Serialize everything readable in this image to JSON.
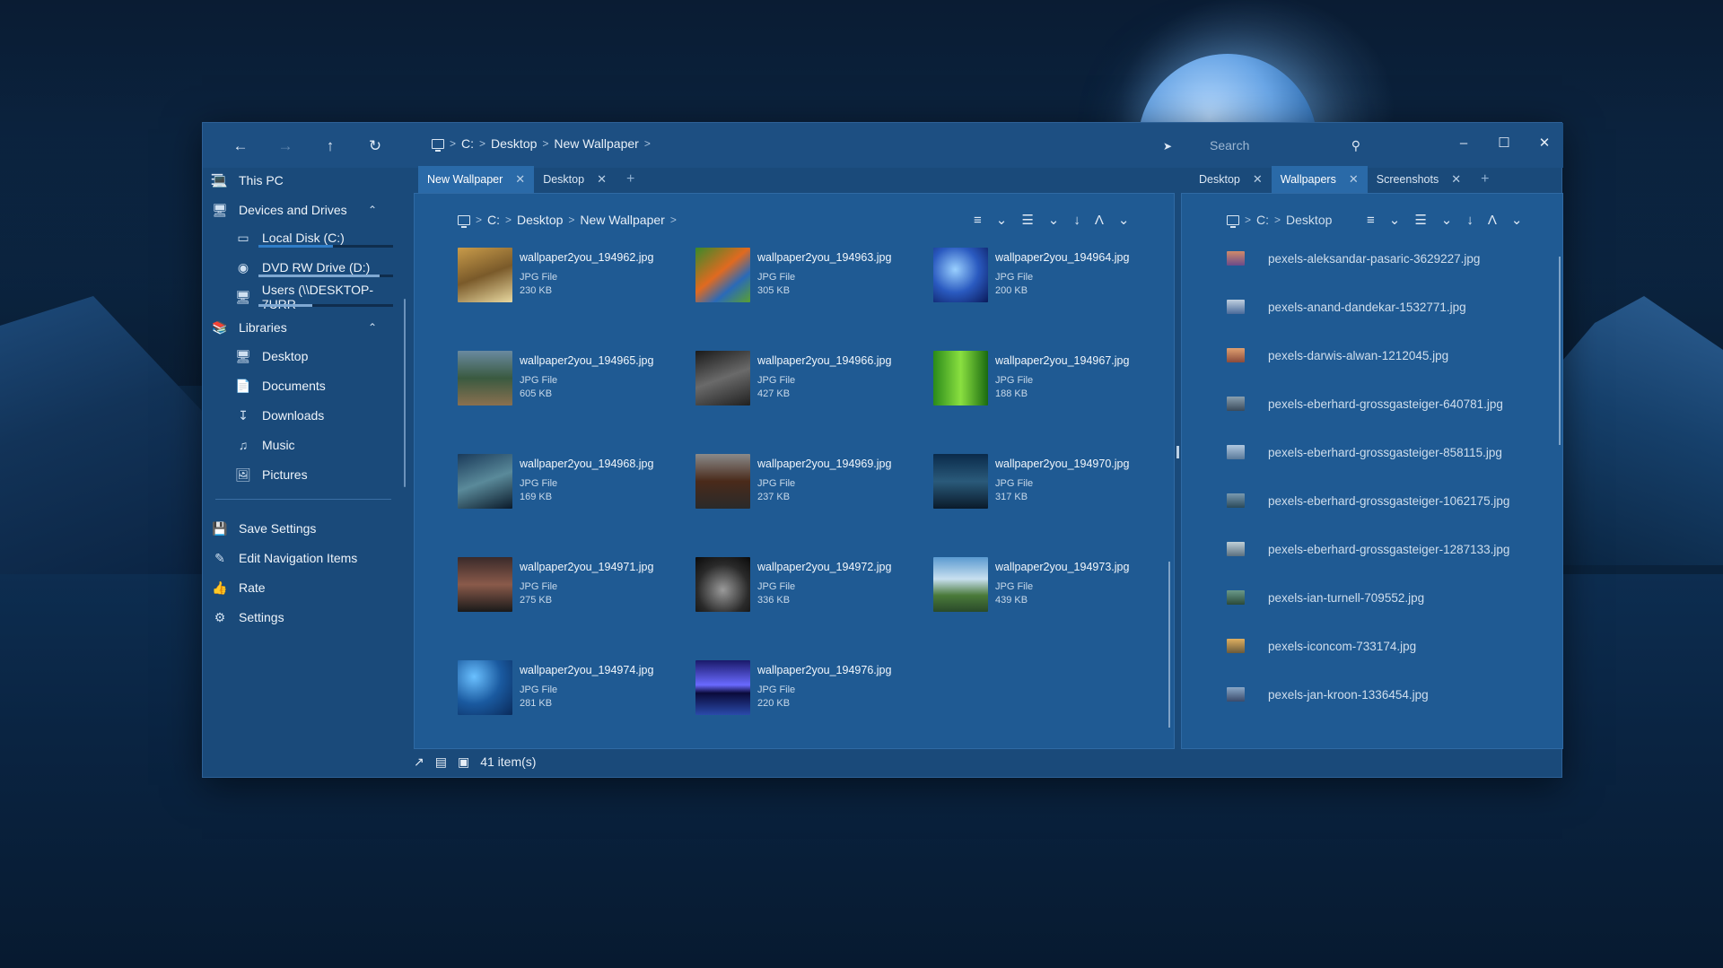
{
  "colors": {
    "accent": "#2a6aa8",
    "window_bg": "#1a4a7a",
    "pane_bg": "#1f5a93"
  },
  "nav": {
    "back_icon": "arrow-left",
    "forward_icon": "arrow-right",
    "up_icon": "arrow-up",
    "refresh_icon": "refresh",
    "breadcrumb": [
      "C:",
      "Desktop",
      "New Wallpaper"
    ],
    "search_placeholder": "Search"
  },
  "tabs_left": [
    {
      "label": "New Wallpaper",
      "active": true
    },
    {
      "label": "Desktop",
      "active": false
    }
  ],
  "tabs_right": [
    {
      "label": "Desktop",
      "active": false
    },
    {
      "label": "Wallpapers",
      "active": true
    },
    {
      "label": "Screenshots",
      "active": false
    }
  ],
  "sidebar": {
    "this_pc": "This PC",
    "devices_section": "Devices and Drives",
    "drives": [
      {
        "label": "Local Disk (C:)",
        "usage": 0.55
      },
      {
        "label": "DVD RW Drive (D:)",
        "usage": 0.9
      },
      {
        "label": "Users (\\\\DESKTOP-7URR",
        "usage": 0.4
      }
    ],
    "libraries_section": "Libraries",
    "libraries": [
      "Desktop",
      "Documents",
      "Downloads",
      "Music",
      "Pictures"
    ],
    "actions": [
      "Save Settings",
      "Edit Navigation Items",
      "Rate",
      "Settings"
    ]
  },
  "pane1": {
    "breadcrumb": [
      "C:",
      "Desktop",
      "New Wallpaper"
    ],
    "files": [
      {
        "name": "wallpaper2you_194962.jpg",
        "type": "JPG File",
        "size": "230 KB"
      },
      {
        "name": "wallpaper2you_194963.jpg",
        "type": "JPG File",
        "size": "305 KB"
      },
      {
        "name": "wallpaper2you_194964.jpg",
        "type": "JPG File",
        "size": "200 KB"
      },
      {
        "name": "wallpaper2you_194965.jpg",
        "type": "JPG File",
        "size": "605 KB"
      },
      {
        "name": "wallpaper2you_194966.jpg",
        "type": "JPG File",
        "size": "427 KB"
      },
      {
        "name": "wallpaper2you_194967.jpg",
        "type": "JPG File",
        "size": "188 KB"
      },
      {
        "name": "wallpaper2you_194968.jpg",
        "type": "JPG File",
        "size": "169 KB"
      },
      {
        "name": "wallpaper2you_194969.jpg",
        "type": "JPG File",
        "size": "237 KB"
      },
      {
        "name": "wallpaper2you_194970.jpg",
        "type": "JPG File",
        "size": "317 KB"
      },
      {
        "name": "wallpaper2you_194971.jpg",
        "type": "JPG File",
        "size": "275 KB"
      },
      {
        "name": "wallpaper2you_194972.jpg",
        "type": "JPG File",
        "size": "336 KB"
      },
      {
        "name": "wallpaper2you_194973.jpg",
        "type": "JPG File",
        "size": "439 KB"
      },
      {
        "name": "wallpaper2you_194974.jpg",
        "type": "JPG File",
        "size": "281 KB"
      },
      {
        "name": "wallpaper2you_194976.jpg",
        "type": "JPG File",
        "size": "220 KB"
      }
    ]
  },
  "pane2": {
    "breadcrumb": [
      "C:",
      "Desktop"
    ],
    "files": [
      "pexels-aleksandar-pasaric-3629227.jpg",
      "pexels-anand-dandekar-1532771.jpg",
      "pexels-darwis-alwan-1212045.jpg",
      "pexels-eberhard-grossgasteiger-640781.jpg",
      "pexels-eberhard-grossgasteiger-858115.jpg",
      "pexels-eberhard-grossgasteiger-1062175.jpg",
      "pexels-eberhard-grossgasteiger-1287133.jpg",
      "pexels-ian-turnell-709552.jpg",
      "pexels-iconcom-733174.jpg",
      "pexels-jan-kroon-1336454.jpg"
    ]
  },
  "status": {
    "item_count": "41 item(s)"
  }
}
